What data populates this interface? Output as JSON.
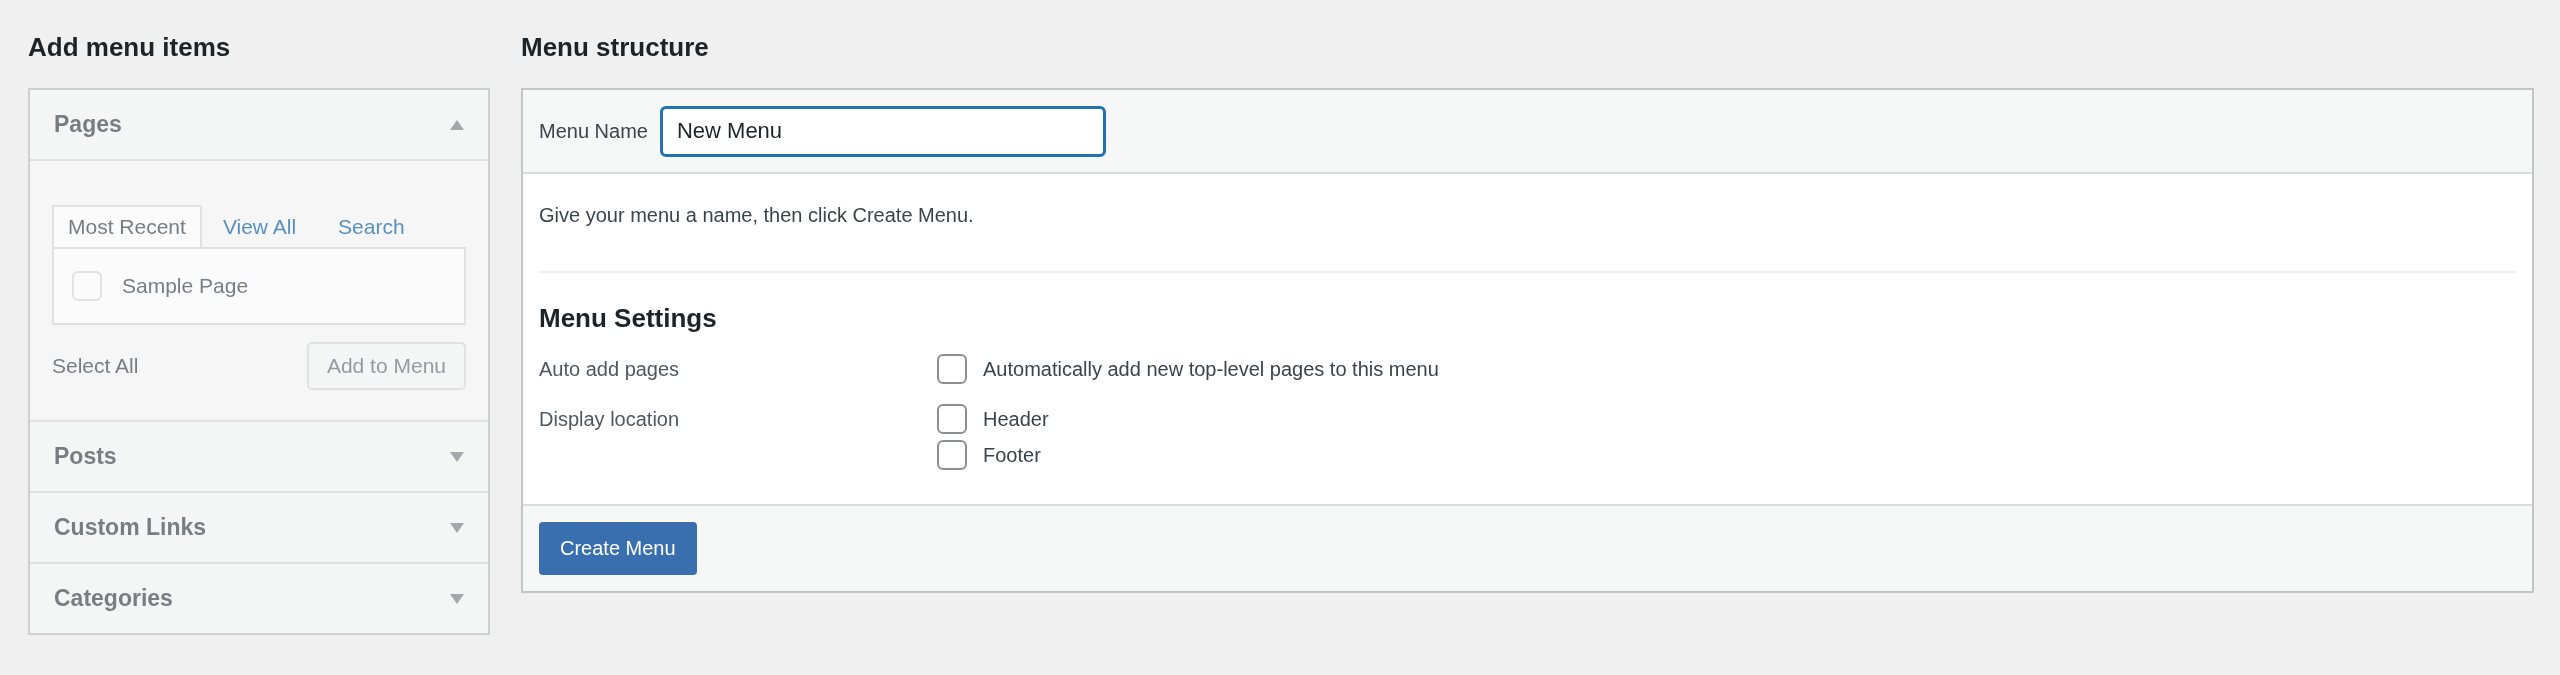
{
  "add_menu_items": {
    "title": "Add menu items",
    "disabled": true,
    "sections": [
      {
        "title": "Pages",
        "expanded": true,
        "tabs": [
          {
            "label": "Most Recent",
            "selected": true
          },
          {
            "label": "View All",
            "selected": false
          },
          {
            "label": "Search",
            "selected": false
          }
        ],
        "items": [
          {
            "label": "Sample Page",
            "checked": false
          }
        ],
        "select_all": "Select All",
        "add_button": "Add to Menu"
      },
      {
        "title": "Posts",
        "expanded": false
      },
      {
        "title": "Custom Links",
        "expanded": false
      },
      {
        "title": "Categories",
        "expanded": false
      }
    ]
  },
  "menu_structure": {
    "title": "Menu structure",
    "menu_name_label": "Menu Name",
    "menu_name_value": "New Menu",
    "instructions": "Give your menu a name, then click Create Menu.",
    "settings_title": "Menu Settings",
    "settings": [
      {
        "label": "Auto add pages",
        "options": [
          {
            "label": "Automatically add new top-level pages to this menu",
            "checked": false
          }
        ]
      },
      {
        "label": "Display location",
        "options": [
          {
            "label": "Header",
            "checked": false
          },
          {
            "label": "Footer",
            "checked": false
          }
        ]
      }
    ],
    "create_button": "Create Menu"
  }
}
